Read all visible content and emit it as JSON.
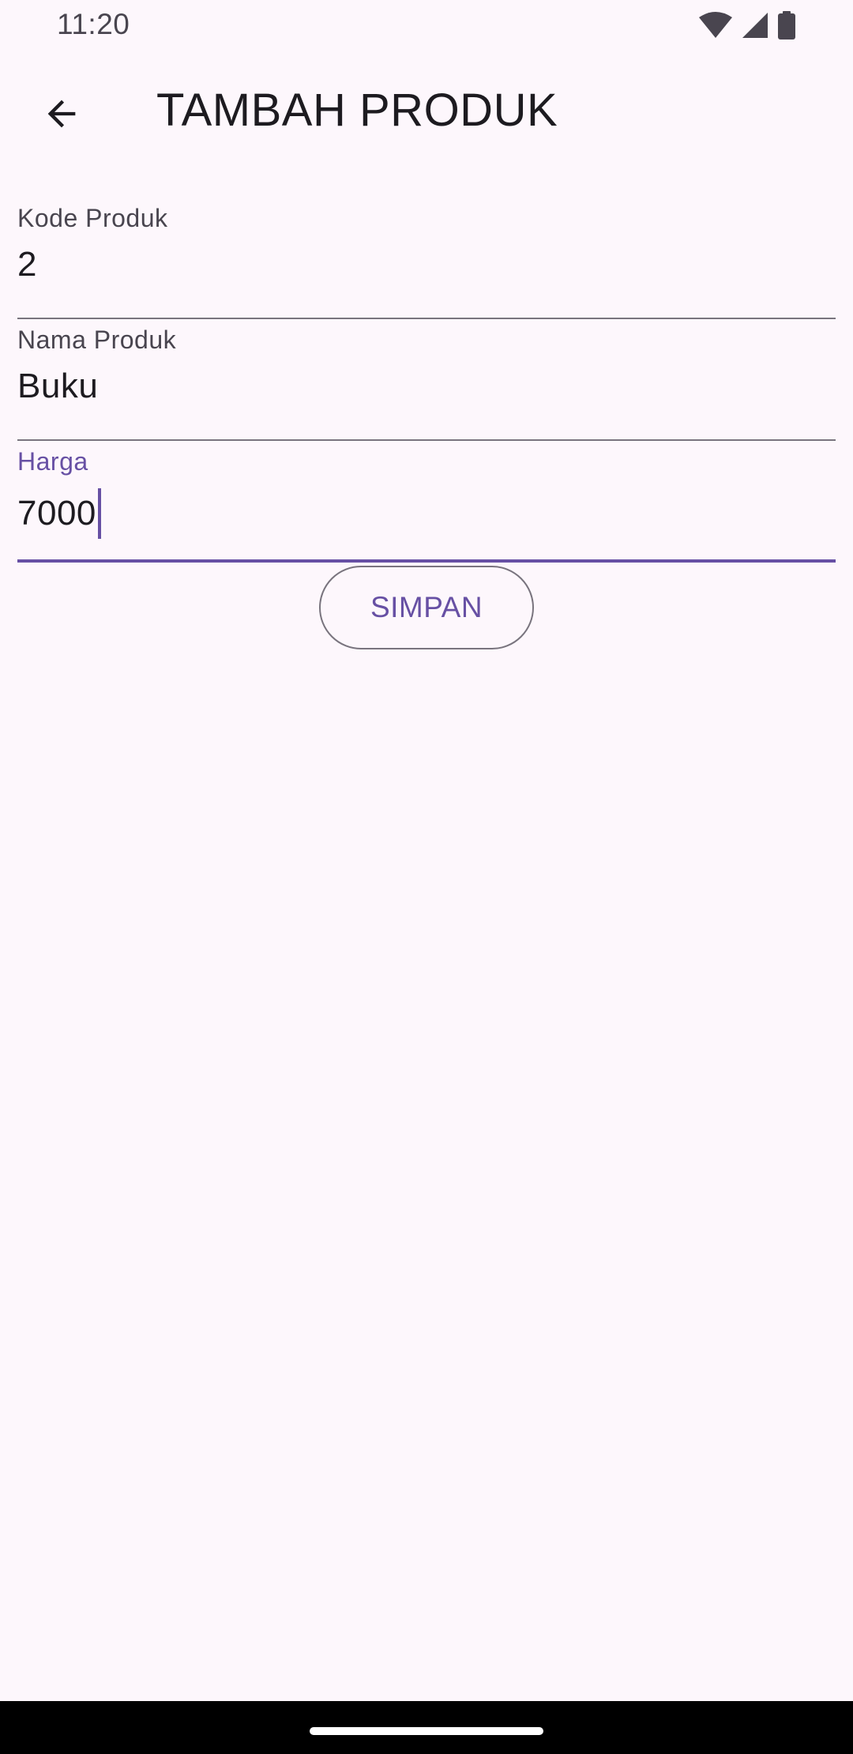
{
  "status_bar": {
    "time": "11:20",
    "icons": [
      "wifi-icon",
      "signal-icon",
      "battery-icon"
    ]
  },
  "app_bar": {
    "title": "TAMBAH PRODUK",
    "back_icon": "arrow-back-icon"
  },
  "form": {
    "fields": [
      {
        "label": "Kode Produk",
        "value": "2",
        "focused": false
      },
      {
        "label": "Nama Produk",
        "value": "Buku",
        "focused": false
      },
      {
        "label": "Harga",
        "value": "7000",
        "focused": true
      }
    ],
    "save_label": "SIMPAN"
  },
  "colors": {
    "background": "#FDF7FC",
    "primary": "#6750A4",
    "text": "#1D1B20",
    "label": "#49454F",
    "outline": "#79747E"
  }
}
